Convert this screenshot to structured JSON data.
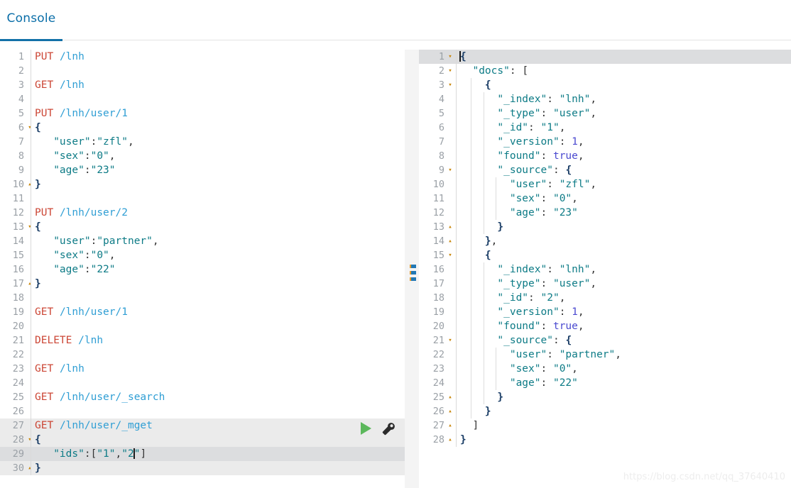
{
  "tab": {
    "label": "Console",
    "accent_color": "#1271a8"
  },
  "icons": {
    "run_label": "play-icon",
    "settings_label": "wrench-icon"
  },
  "watermark": "https://blog.csdn.net/qq_37640410",
  "request_editor": {
    "name": "request-editor",
    "active_lines": [
      27,
      28,
      29,
      30
    ],
    "cursor": {
      "line": 29,
      "column": 16
    },
    "lines": [
      {
        "n": 1,
        "fold": "",
        "tokens": [
          {
            "t": "PUT",
            "c": "mth"
          },
          {
            "t": " ",
            "c": "pun"
          },
          {
            "t": "/lnh",
            "c": "pth"
          }
        ]
      },
      {
        "n": 2,
        "fold": "",
        "tokens": []
      },
      {
        "n": 3,
        "fold": "",
        "tokens": [
          {
            "t": "GET",
            "c": "mth"
          },
          {
            "t": " ",
            "c": "pun"
          },
          {
            "t": "/lnh",
            "c": "pth"
          }
        ]
      },
      {
        "n": 4,
        "fold": "",
        "tokens": []
      },
      {
        "n": 5,
        "fold": "",
        "tokens": [
          {
            "t": "PUT",
            "c": "mth"
          },
          {
            "t": " ",
            "c": "pun"
          },
          {
            "t": "/lnh/user/1",
            "c": "pth"
          }
        ]
      },
      {
        "n": 6,
        "fold": "▾",
        "tokens": [
          {
            "t": "{",
            "c": "brc"
          }
        ]
      },
      {
        "n": 7,
        "fold": "",
        "tokens": [
          {
            "t": "   ",
            "c": "pun"
          },
          {
            "t": "\"user\"",
            "c": "str"
          },
          {
            "t": ":",
            "c": "pun"
          },
          {
            "t": "\"zfl\"",
            "c": "str"
          },
          {
            "t": ",",
            "c": "pun"
          }
        ]
      },
      {
        "n": 8,
        "fold": "",
        "tokens": [
          {
            "t": "   ",
            "c": "pun"
          },
          {
            "t": "\"sex\"",
            "c": "str"
          },
          {
            "t": ":",
            "c": "pun"
          },
          {
            "t": "\"0\"",
            "c": "str"
          },
          {
            "t": ",",
            "c": "pun"
          }
        ]
      },
      {
        "n": 9,
        "fold": "",
        "tokens": [
          {
            "t": "   ",
            "c": "pun"
          },
          {
            "t": "\"age\"",
            "c": "str"
          },
          {
            "t": ":",
            "c": "pun"
          },
          {
            "t": "\"23\"",
            "c": "str"
          }
        ]
      },
      {
        "n": 10,
        "fold": "▴",
        "tokens": [
          {
            "t": "}",
            "c": "brc"
          }
        ]
      },
      {
        "n": 11,
        "fold": "",
        "tokens": []
      },
      {
        "n": 12,
        "fold": "",
        "tokens": [
          {
            "t": "PUT",
            "c": "mth"
          },
          {
            "t": " ",
            "c": "pun"
          },
          {
            "t": "/lnh/user/2",
            "c": "pth"
          }
        ]
      },
      {
        "n": 13,
        "fold": "▾",
        "tokens": [
          {
            "t": "{",
            "c": "brc"
          }
        ]
      },
      {
        "n": 14,
        "fold": "",
        "tokens": [
          {
            "t": "   ",
            "c": "pun"
          },
          {
            "t": "\"user\"",
            "c": "str"
          },
          {
            "t": ":",
            "c": "pun"
          },
          {
            "t": "\"partner\"",
            "c": "str"
          },
          {
            "t": ",",
            "c": "pun"
          }
        ]
      },
      {
        "n": 15,
        "fold": "",
        "tokens": [
          {
            "t": "   ",
            "c": "pun"
          },
          {
            "t": "\"sex\"",
            "c": "str"
          },
          {
            "t": ":",
            "c": "pun"
          },
          {
            "t": "\"0\"",
            "c": "str"
          },
          {
            "t": ",",
            "c": "pun"
          }
        ]
      },
      {
        "n": 16,
        "fold": "",
        "tokens": [
          {
            "t": "   ",
            "c": "pun"
          },
          {
            "t": "\"age\"",
            "c": "str"
          },
          {
            "t": ":",
            "c": "pun"
          },
          {
            "t": "\"22\"",
            "c": "str"
          }
        ]
      },
      {
        "n": 17,
        "fold": "▴",
        "tokens": [
          {
            "t": "}",
            "c": "brc"
          }
        ]
      },
      {
        "n": 18,
        "fold": "",
        "tokens": []
      },
      {
        "n": 19,
        "fold": "",
        "tokens": [
          {
            "t": "GET",
            "c": "mth"
          },
          {
            "t": " ",
            "c": "pun"
          },
          {
            "t": "/lnh/user/1",
            "c": "pth"
          }
        ]
      },
      {
        "n": 20,
        "fold": "",
        "tokens": []
      },
      {
        "n": 21,
        "fold": "",
        "tokens": [
          {
            "t": "DELETE",
            "c": "mth"
          },
          {
            "t": " ",
            "c": "pun"
          },
          {
            "t": "/lnh",
            "c": "pth"
          }
        ]
      },
      {
        "n": 22,
        "fold": "",
        "tokens": []
      },
      {
        "n": 23,
        "fold": "",
        "tokens": [
          {
            "t": "GET",
            "c": "mth"
          },
          {
            "t": " ",
            "c": "pun"
          },
          {
            "t": "/lnh",
            "c": "pth"
          }
        ]
      },
      {
        "n": 24,
        "fold": "",
        "tokens": []
      },
      {
        "n": 25,
        "fold": "",
        "tokens": [
          {
            "t": "GET",
            "c": "mth"
          },
          {
            "t": " ",
            "c": "pun"
          },
          {
            "t": "/lnh/user/_search",
            "c": "pth"
          }
        ]
      },
      {
        "n": 26,
        "fold": "",
        "tokens": []
      },
      {
        "n": 27,
        "fold": "",
        "tokens": [
          {
            "t": "GET",
            "c": "mth"
          },
          {
            "t": " ",
            "c": "pun"
          },
          {
            "t": "/lnh/user/_mget",
            "c": "pth"
          }
        ]
      },
      {
        "n": 28,
        "fold": "▾",
        "tokens": [
          {
            "t": "{",
            "c": "brc"
          }
        ]
      },
      {
        "n": 29,
        "fold": "",
        "tokens": [
          {
            "t": "   ",
            "c": "pun"
          },
          {
            "t": "\"ids\"",
            "c": "str"
          },
          {
            "t": ":",
            "c": "pun"
          },
          {
            "t": "[",
            "c": "pun"
          },
          {
            "t": "\"1\"",
            "c": "str"
          },
          {
            "t": ",",
            "c": "pun"
          },
          {
            "t": "\"2",
            "c": "str"
          },
          {
            "t": "|",
            "c": "caret"
          },
          {
            "t": "\"",
            "c": "str"
          },
          {
            "t": "]",
            "c": "pun"
          }
        ]
      },
      {
        "n": 30,
        "fold": "▴",
        "tokens": [
          {
            "t": "}",
            "c": "brc"
          }
        ]
      }
    ]
  },
  "response_editor": {
    "name": "response-editor",
    "active_lines": [
      1
    ],
    "cursor": {
      "line": 1,
      "column": 1
    },
    "lines": [
      {
        "n": 1,
        "fold": "▾",
        "indent": 0,
        "tokens": [
          {
            "t": "|",
            "c": "caret"
          },
          {
            "t": "{",
            "c": "brc"
          }
        ]
      },
      {
        "n": 2,
        "fold": "▾",
        "indent": 0,
        "tokens": [
          {
            "t": "  ",
            "c": "pun"
          },
          {
            "t": "\"docs\"",
            "c": "str"
          },
          {
            "t": ": ",
            "c": "pun"
          },
          {
            "t": "[",
            "c": "pun"
          }
        ]
      },
      {
        "n": 3,
        "fold": "▾",
        "indent": 1,
        "tokens": [
          {
            "t": "    ",
            "c": "pun"
          },
          {
            "t": "{",
            "c": "brc"
          }
        ]
      },
      {
        "n": 4,
        "fold": "",
        "indent": 2,
        "tokens": [
          {
            "t": "      ",
            "c": "pun"
          },
          {
            "t": "\"_index\"",
            "c": "str"
          },
          {
            "t": ": ",
            "c": "pun"
          },
          {
            "t": "\"lnh\"",
            "c": "str"
          },
          {
            "t": ",",
            "c": "pun"
          }
        ]
      },
      {
        "n": 5,
        "fold": "",
        "indent": 2,
        "tokens": [
          {
            "t": "      ",
            "c": "pun"
          },
          {
            "t": "\"_type\"",
            "c": "str"
          },
          {
            "t": ": ",
            "c": "pun"
          },
          {
            "t": "\"user\"",
            "c": "str"
          },
          {
            "t": ",",
            "c": "pun"
          }
        ]
      },
      {
        "n": 6,
        "fold": "",
        "indent": 2,
        "tokens": [
          {
            "t": "      ",
            "c": "pun"
          },
          {
            "t": "\"_id\"",
            "c": "str"
          },
          {
            "t": ": ",
            "c": "pun"
          },
          {
            "t": "\"1\"",
            "c": "str"
          },
          {
            "t": ",",
            "c": "pun"
          }
        ]
      },
      {
        "n": 7,
        "fold": "",
        "indent": 2,
        "tokens": [
          {
            "t": "      ",
            "c": "pun"
          },
          {
            "t": "\"_version\"",
            "c": "str"
          },
          {
            "t": ": ",
            "c": "pun"
          },
          {
            "t": "1",
            "c": "num"
          },
          {
            "t": ",",
            "c": "pun"
          }
        ]
      },
      {
        "n": 8,
        "fold": "",
        "indent": 2,
        "tokens": [
          {
            "t": "      ",
            "c": "pun"
          },
          {
            "t": "\"found\"",
            "c": "str"
          },
          {
            "t": ": ",
            "c": "pun"
          },
          {
            "t": "true",
            "c": "num"
          },
          {
            "t": ",",
            "c": "pun"
          }
        ]
      },
      {
        "n": 9,
        "fold": "▾",
        "indent": 2,
        "tokens": [
          {
            "t": "      ",
            "c": "pun"
          },
          {
            "t": "\"_source\"",
            "c": "str"
          },
          {
            "t": ": ",
            "c": "pun"
          },
          {
            "t": "{",
            "c": "brc"
          }
        ]
      },
      {
        "n": 10,
        "fold": "",
        "indent": 3,
        "tokens": [
          {
            "t": "        ",
            "c": "pun"
          },
          {
            "t": "\"user\"",
            "c": "str"
          },
          {
            "t": ": ",
            "c": "pun"
          },
          {
            "t": "\"zfl\"",
            "c": "str"
          },
          {
            "t": ",",
            "c": "pun"
          }
        ]
      },
      {
        "n": 11,
        "fold": "",
        "indent": 3,
        "tokens": [
          {
            "t": "        ",
            "c": "pun"
          },
          {
            "t": "\"sex\"",
            "c": "str"
          },
          {
            "t": ": ",
            "c": "pun"
          },
          {
            "t": "\"0\"",
            "c": "str"
          },
          {
            "t": ",",
            "c": "pun"
          }
        ]
      },
      {
        "n": 12,
        "fold": "",
        "indent": 3,
        "tokens": [
          {
            "t": "        ",
            "c": "pun"
          },
          {
            "t": "\"age\"",
            "c": "str"
          },
          {
            "t": ": ",
            "c": "pun"
          },
          {
            "t": "\"23\"",
            "c": "str"
          }
        ]
      },
      {
        "n": 13,
        "fold": "▴",
        "indent": 2,
        "tokens": [
          {
            "t": "      ",
            "c": "pun"
          },
          {
            "t": "}",
            "c": "brc"
          }
        ]
      },
      {
        "n": 14,
        "fold": "▴",
        "indent": 1,
        "tokens": [
          {
            "t": "    ",
            "c": "pun"
          },
          {
            "t": "}",
            "c": "brc"
          },
          {
            "t": ",",
            "c": "pun"
          }
        ]
      },
      {
        "n": 15,
        "fold": "▾",
        "indent": 1,
        "tokens": [
          {
            "t": "    ",
            "c": "pun"
          },
          {
            "t": "{",
            "c": "brc"
          }
        ]
      },
      {
        "n": 16,
        "fold": "",
        "indent": 2,
        "tokens": [
          {
            "t": "      ",
            "c": "pun"
          },
          {
            "t": "\"_index\"",
            "c": "str"
          },
          {
            "t": ": ",
            "c": "pun"
          },
          {
            "t": "\"lnh\"",
            "c": "str"
          },
          {
            "t": ",",
            "c": "pun"
          }
        ]
      },
      {
        "n": 17,
        "fold": "",
        "indent": 2,
        "tokens": [
          {
            "t": "      ",
            "c": "pun"
          },
          {
            "t": "\"_type\"",
            "c": "str"
          },
          {
            "t": ": ",
            "c": "pun"
          },
          {
            "t": "\"user\"",
            "c": "str"
          },
          {
            "t": ",",
            "c": "pun"
          }
        ]
      },
      {
        "n": 18,
        "fold": "",
        "indent": 2,
        "tokens": [
          {
            "t": "      ",
            "c": "pun"
          },
          {
            "t": "\"_id\"",
            "c": "str"
          },
          {
            "t": ": ",
            "c": "pun"
          },
          {
            "t": "\"2\"",
            "c": "str"
          },
          {
            "t": ",",
            "c": "pun"
          }
        ]
      },
      {
        "n": 19,
        "fold": "",
        "indent": 2,
        "tokens": [
          {
            "t": "      ",
            "c": "pun"
          },
          {
            "t": "\"_version\"",
            "c": "str"
          },
          {
            "t": ": ",
            "c": "pun"
          },
          {
            "t": "1",
            "c": "num"
          },
          {
            "t": ",",
            "c": "pun"
          }
        ]
      },
      {
        "n": 20,
        "fold": "",
        "indent": 2,
        "tokens": [
          {
            "t": "      ",
            "c": "pun"
          },
          {
            "t": "\"found\"",
            "c": "str"
          },
          {
            "t": ": ",
            "c": "pun"
          },
          {
            "t": "true",
            "c": "num"
          },
          {
            "t": ",",
            "c": "pun"
          }
        ]
      },
      {
        "n": 21,
        "fold": "▾",
        "indent": 2,
        "tokens": [
          {
            "t": "      ",
            "c": "pun"
          },
          {
            "t": "\"_source\"",
            "c": "str"
          },
          {
            "t": ": ",
            "c": "pun"
          },
          {
            "t": "{",
            "c": "brc"
          }
        ]
      },
      {
        "n": 22,
        "fold": "",
        "indent": 3,
        "tokens": [
          {
            "t": "        ",
            "c": "pun"
          },
          {
            "t": "\"user\"",
            "c": "str"
          },
          {
            "t": ": ",
            "c": "pun"
          },
          {
            "t": "\"partner\"",
            "c": "str"
          },
          {
            "t": ",",
            "c": "pun"
          }
        ]
      },
      {
        "n": 23,
        "fold": "",
        "indent": 3,
        "tokens": [
          {
            "t": "        ",
            "c": "pun"
          },
          {
            "t": "\"sex\"",
            "c": "str"
          },
          {
            "t": ": ",
            "c": "pun"
          },
          {
            "t": "\"0\"",
            "c": "str"
          },
          {
            "t": ",",
            "c": "pun"
          }
        ]
      },
      {
        "n": 24,
        "fold": "",
        "indent": 3,
        "tokens": [
          {
            "t": "        ",
            "c": "pun"
          },
          {
            "t": "\"age\"",
            "c": "str"
          },
          {
            "t": ": ",
            "c": "pun"
          },
          {
            "t": "\"22\"",
            "c": "str"
          }
        ]
      },
      {
        "n": 25,
        "fold": "▴",
        "indent": 2,
        "tokens": [
          {
            "t": "      ",
            "c": "pun"
          },
          {
            "t": "}",
            "c": "brc"
          }
        ]
      },
      {
        "n": 26,
        "fold": "▴",
        "indent": 1,
        "tokens": [
          {
            "t": "    ",
            "c": "pun"
          },
          {
            "t": "}",
            "c": "brc"
          }
        ]
      },
      {
        "n": 27,
        "fold": "▴",
        "indent": 0,
        "tokens": [
          {
            "t": "  ",
            "c": "pun"
          },
          {
            "t": "]",
            "c": "pun"
          }
        ]
      },
      {
        "n": 28,
        "fold": "▴",
        "indent": 0,
        "tokens": [
          {
            "t": "}",
            "c": "brc"
          }
        ]
      }
    ]
  }
}
